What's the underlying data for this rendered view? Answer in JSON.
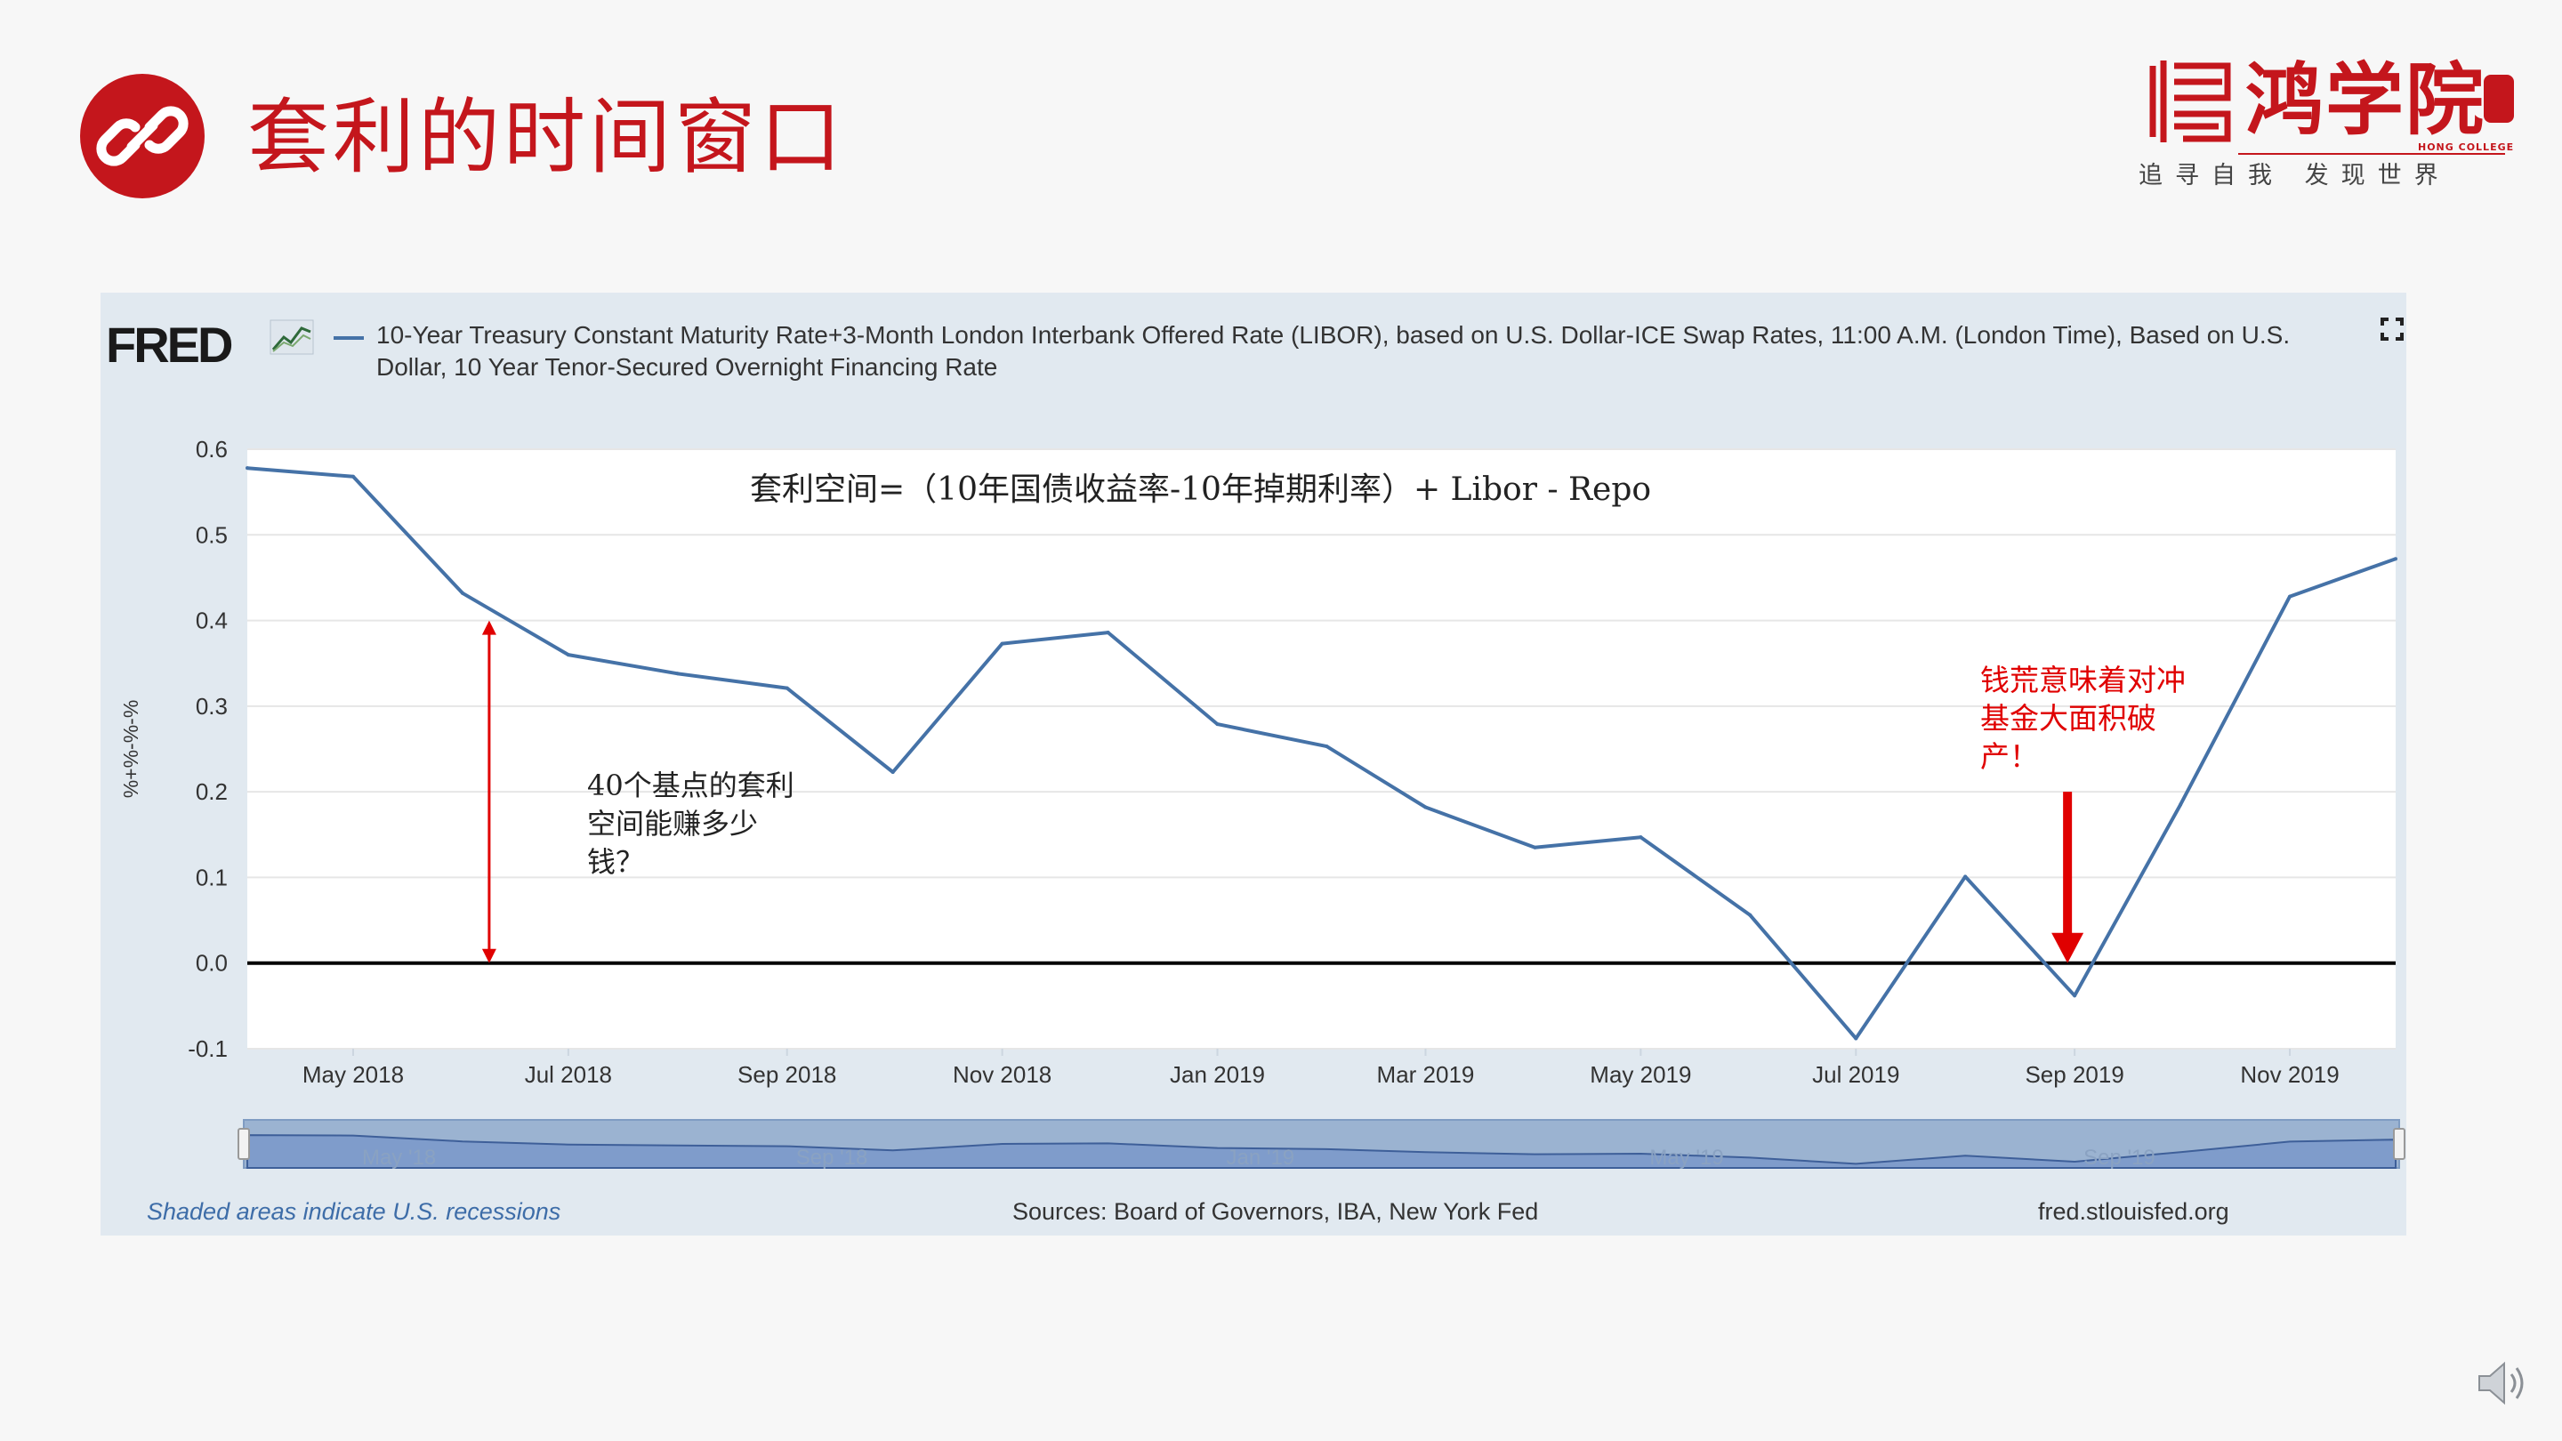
{
  "slide": {
    "title": "套利的时间窗口",
    "accent_color": "#c4161c",
    "icon": "link-icon",
    "logo": {
      "name": "鸿学院",
      "english": "HONG COLLEGE",
      "slogan": "追寻自我 发现世界"
    },
    "speaker_icon": "speaker-icon"
  },
  "fred": {
    "logo_text": "FRED",
    "series_title": "10-Year Treasury Constant Maturity Rate+3-Month London Interbank Offered Rate (LIBOR), based on U.S. Dollar-ICE Swap Rates, 11:00 A.M. (London Time), Based on U.S. Dollar, 10 Year Tenor-Secured Overnight Financing Rate",
    "footer_left": "Shaded areas indicate U.S. recessions",
    "footer_center": "Sources: Board of Governors, IBA, New York Fed",
    "footer_right": "fred.stlouisfed.org",
    "series_color": "#4572a7",
    "fullscreen_icon": "fullscreen-icon"
  },
  "annotations": {
    "formula": "套利空间=（10年国债收益率-10年掉期利率）+ Libor - Repo",
    "left_text": "40个基点的套利空间能赚多少钱？",
    "right_text": "钱荒意味着对冲基金大面积破产！",
    "arrow_color": "#e00000"
  },
  "chart_data": {
    "type": "line",
    "title": "",
    "ylabel": "%+%-%-%",
    "xlabel": "",
    "ylim": [
      -0.1,
      0.6
    ],
    "yticks": [
      "0.6",
      "0.5",
      "0.4",
      "0.3",
      "0.2",
      "0.1",
      "0.0",
      "-0.1"
    ],
    "xlim": [
      "2018-04-01",
      "2019-12-01"
    ],
    "xtick_labels": [
      "May 2018",
      "Jul 2018",
      "Sep 2018",
      "Nov 2018",
      "Jan 2019",
      "Mar 2019",
      "May 2019",
      "Jul 2019",
      "Sep 2019",
      "Nov 2019"
    ],
    "navigator_labels": [
      "May '18",
      "Sep '18",
      "Jan '19",
      "May '19",
      "Sep '19"
    ],
    "grid": true,
    "zero_line": true,
    "series": [
      {
        "x": [
          "2018-04-01",
          "2018-05-01",
          "2018-06-01",
          "2018-07-01",
          "2018-08-01",
          "2018-09-01",
          "2018-10-01",
          "2018-11-01",
          "2018-12-01",
          "2019-01-01",
          "2019-02-01",
          "2019-03-01",
          "2019-04-01",
          "2019-05-01",
          "2019-06-01",
          "2019-07-01",
          "2019-08-01",
          "2019-09-01",
          "2019-10-01",
          "2019-11-01",
          "2019-12-01"
        ],
        "values": [
          0.578,
          0.568,
          0.432,
          0.36,
          0.338,
          0.321,
          0.223,
          0.373,
          0.386,
          0.279,
          0.253,
          0.182,
          0.135,
          0.147,
          0.056,
          -0.088,
          0.101,
          -0.038,
          0.185,
          0.428,
          0.472
        ]
      }
    ],
    "annotations": [
      {
        "type": "double-arrow",
        "x": "2018-06-01",
        "y_from": 0.0,
        "y_to": 0.4,
        "label": "40个基点的套利空间能赚多少钱？"
      },
      {
        "type": "down-arrow",
        "x": "2019-09-01",
        "y_from": 0.2,
        "y_to": 0.0,
        "label": "钱荒意味着对冲基金大面积破产！"
      }
    ]
  }
}
